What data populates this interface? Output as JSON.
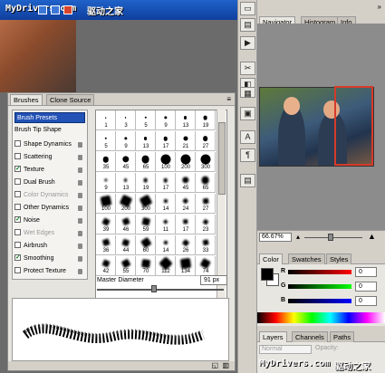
{
  "watermark": {
    "site": "MyDrivers.com",
    "cn": "驱动之家"
  },
  "brushes_panel": {
    "tabs": [
      "Brushes",
      "Clone Source"
    ],
    "presets_label": "Brush Presets",
    "tip_shape_label": "Brush Tip Shape",
    "options": [
      {
        "label": "Shape Dynamics",
        "checked": false,
        "disabled": false
      },
      {
        "label": "Scattering",
        "checked": false,
        "disabled": false
      },
      {
        "label": "Texture",
        "checked": true,
        "disabled": false
      },
      {
        "label": "Dual Brush",
        "checked": false,
        "disabled": false
      },
      {
        "label": "Color Dynamics",
        "checked": false,
        "disabled": true
      },
      {
        "label": "Other Dynamics",
        "checked": false,
        "disabled": false
      },
      {
        "label": "Noise",
        "checked": true,
        "disabled": false
      },
      {
        "label": "Wet Edges",
        "checked": false,
        "disabled": true
      },
      {
        "label": "Airbrush",
        "checked": false,
        "disabled": false
      },
      {
        "label": "Smoothing",
        "checked": true,
        "disabled": false
      },
      {
        "label": "Protect Texture",
        "checked": false,
        "disabled": false
      }
    ],
    "brush_sizes": [
      "1",
      "3",
      "5",
      "9",
      "13",
      "19",
      "5",
      "9",
      "13",
      "17",
      "21",
      "27",
      "35",
      "45",
      "65",
      "100",
      "200",
      "300",
      "9",
      "13",
      "19",
      "17",
      "45",
      "65",
      "100",
      "200",
      "300",
      "14",
      "24",
      "27",
      "39",
      "46",
      "59",
      "11",
      "17",
      "23",
      "36",
      "44",
      "60",
      "14",
      "26",
      "33",
      "42",
      "55",
      "70",
      "112",
      "134",
      "74"
    ],
    "master_diameter_label": "Master Diameter",
    "master_diameter_value": "91 px",
    "master_diameter_fraction": 0.45
  },
  "navigator_panel": {
    "tabs": [
      "Navigator",
      "Histogram",
      "Info"
    ],
    "zoom": "66.67%"
  },
  "color_panel": {
    "tabs": [
      "Color",
      "Swatches",
      "Styles"
    ],
    "channels": [
      {
        "label": "R",
        "value": "0"
      },
      {
        "label": "G",
        "value": "0"
      },
      {
        "label": "B",
        "value": "0"
      }
    ]
  },
  "layers_panel": {
    "tabs": [
      "Layers",
      "Channels",
      "Paths"
    ],
    "mode": "Normal",
    "opacity_label": "Opacity:"
  }
}
